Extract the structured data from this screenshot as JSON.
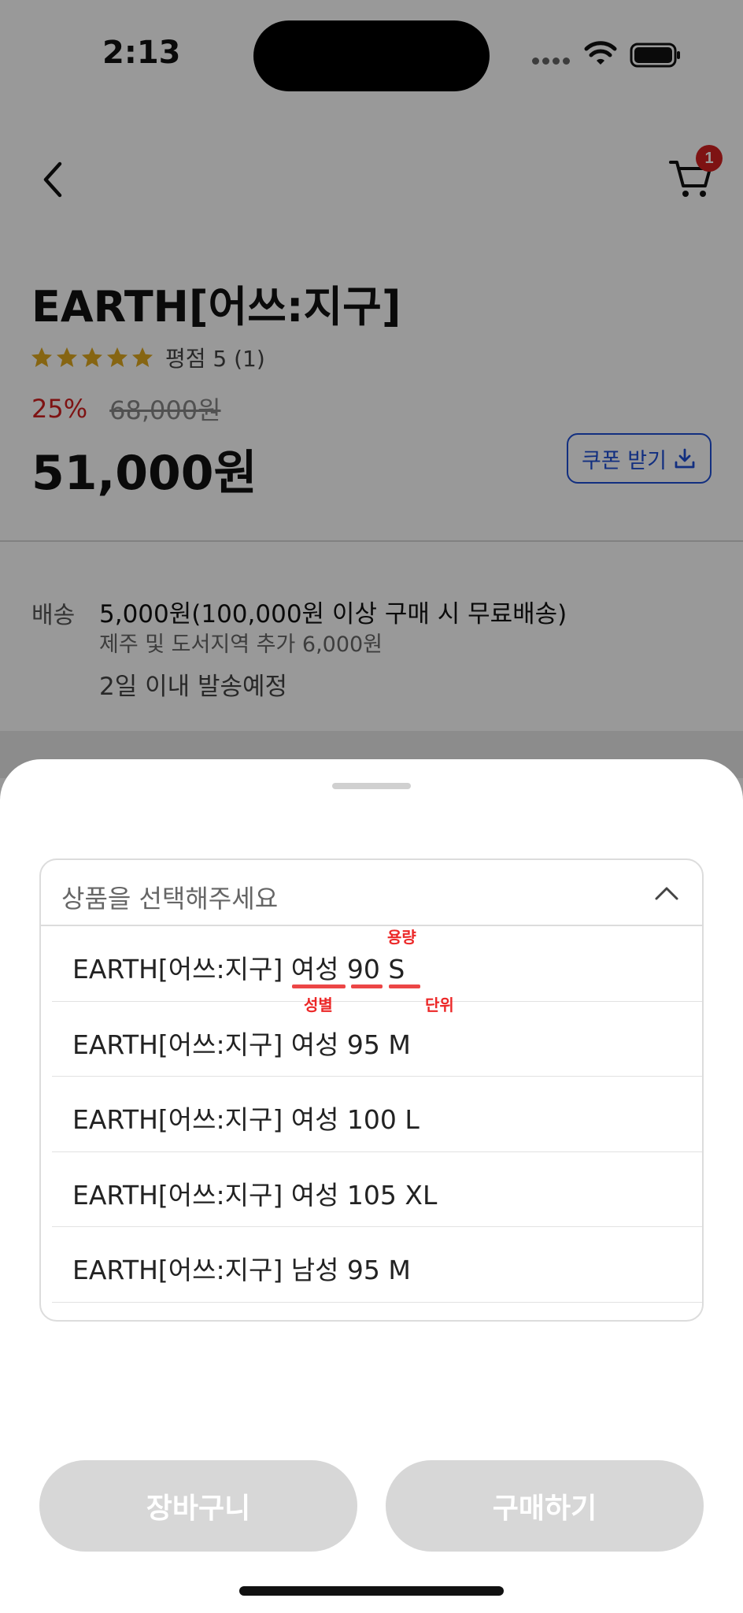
{
  "status_bar": {
    "time": "2:13"
  },
  "nav": {
    "cart_badge_count": "1"
  },
  "product": {
    "title": "EARTH[어쓰:지구]",
    "rating_text": "평점 5 (1)",
    "star_count": 5,
    "star_color": "#e0a81e",
    "discount_rate": "25%",
    "original_price": "68,000원",
    "sale_price": "51,000원",
    "coupon_label": "쿠폰 받기"
  },
  "shipping": {
    "label": "배송",
    "fee": "5,000원(100,000원 이상 구매 시 무료배송)",
    "extra": "제주 및 도서지역 추가 6,000원",
    "eta": "2일 이내 발송예정"
  },
  "sheet": {
    "select_placeholder": "상품을 선택해주세요",
    "options": [
      {
        "label": "EARTH[어쓰:지구] 여성 90 S"
      },
      {
        "label": "EARTH[어쓰:지구] 여성 95 M"
      },
      {
        "label": "EARTH[어쓰:지구] 여성 100 L"
      },
      {
        "label": "EARTH[어쓰:지구] 여성 105 XL"
      },
      {
        "label": "EARTH[어쓰:지구] 남성 95 M"
      }
    ],
    "annotations": {
      "capacity": "용량",
      "gender": "성별",
      "unit": "단위"
    },
    "cart_button": "장바구니",
    "buy_button": "구매하기"
  },
  "colors": {
    "accent_blue": "#1f4fd6",
    "discount_red": "#d32020",
    "annotation_red": "#ec2828",
    "disabled_button": "#d7d7d7"
  }
}
